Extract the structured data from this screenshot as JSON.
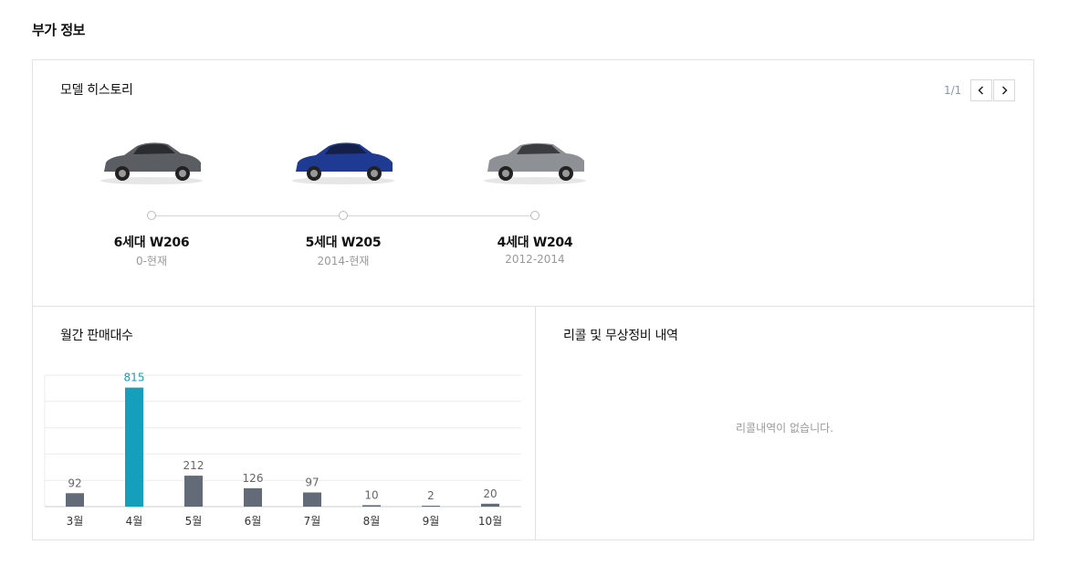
{
  "section_title": "부가 정보",
  "history": {
    "title": "모델 히스토리",
    "pager": {
      "current": "1/1"
    },
    "models": [
      {
        "name": "6세대 W206",
        "years": "0-현재",
        "car_color": "#5a5d62"
      },
      {
        "name": "5세대 W205",
        "years": "2014-현재",
        "car_color": "#1f3a93"
      },
      {
        "name": "4세대 W204",
        "years": "2012-2014",
        "car_color": "#8d9094"
      }
    ]
  },
  "sales": {
    "title": "월간 판매대수",
    "chart_data": {
      "type": "bar",
      "categories": [
        "3월",
        "4월",
        "5월",
        "6월",
        "7월",
        "8월",
        "9월",
        "10월"
      ],
      "values": [
        92,
        815,
        212,
        126,
        97,
        10,
        2,
        20
      ],
      "highlight_index": 1,
      "ylim": [
        0,
        900
      ],
      "colors": {
        "bar": "#646b78",
        "highlight": "#169ebd",
        "label": "#666666",
        "highlight_label": "#169ebd",
        "grid": "#ebebeb",
        "axis": "#cccccc"
      },
      "grid": true
    }
  },
  "recall": {
    "title": "리콜 및 무상정비 내역",
    "empty_message": "리콜내역이 없습니다."
  }
}
